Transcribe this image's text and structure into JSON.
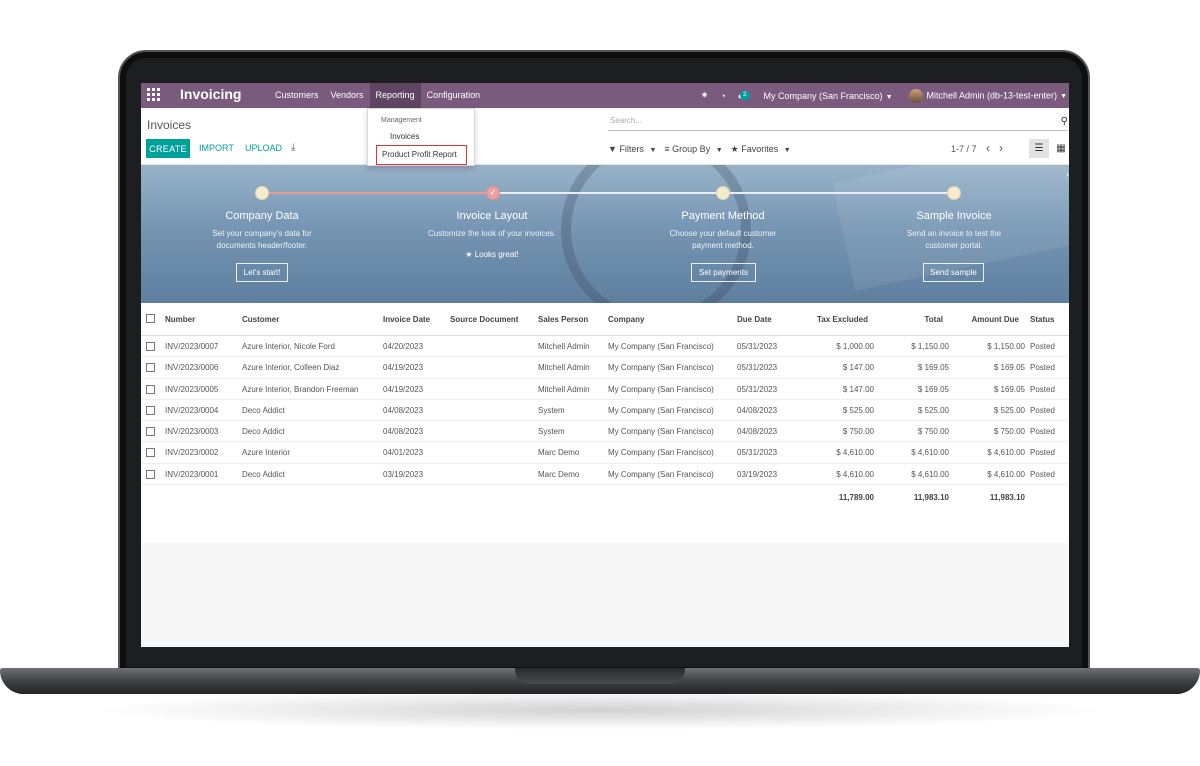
{
  "navbar": {
    "brand": "Invoicing",
    "menu": [
      "Customers",
      "Vendors",
      "Reporting",
      "Configuration"
    ],
    "chat_badge": "2",
    "company": "My Company (San Francisco)",
    "user": "Mitchell Admin (db-13-test-enter)"
  },
  "control_panel": {
    "title": "Invoices",
    "create_label": "CREATE",
    "import_label": "IMPORT",
    "upload_label": "UPLOAD",
    "search_placeholder": "Search...",
    "filters_label": "Filters",
    "group_by_label": "Group By",
    "favorites_label": "Favorites",
    "pager": "1-7 / 7"
  },
  "reporting_menu": {
    "header": "Management",
    "items": [
      "Invoices",
      "Product Profit Report"
    ]
  },
  "onboarding": {
    "steps": [
      {
        "title": "Company Data",
        "desc_line1": "Set your company's data for",
        "desc_line2": "documents header/footer.",
        "button": "Let's start!",
        "done": false
      },
      {
        "title": "Invoice Layout",
        "desc_line1": "Customize the look of your invoices.",
        "desc_line2": "",
        "button": "",
        "done": true,
        "done_label": "Looks great!"
      },
      {
        "title": "Payment Method",
        "desc_line1": "Choose your default customer",
        "desc_line2": "payment method.",
        "button": "Set payments",
        "done": false
      },
      {
        "title": "Sample Invoice",
        "desc_line1": "Send an invoice to test the",
        "desc_line2": "customer portal.",
        "button": "Send sample",
        "done": false
      }
    ]
  },
  "table": {
    "columns": [
      "Number",
      "Customer",
      "Invoice Date",
      "Source Document",
      "Sales Person",
      "Company",
      "Due Date",
      "Tax Excluded",
      "Total",
      "Amount Due",
      "Status"
    ],
    "rows": [
      {
        "number": "INV/2023/0007",
        "customer": "Azure Interior, Nicole Ford",
        "invoice_date": "04/20/2023",
        "source": "",
        "salesperson": "Mitchell Admin",
        "company": "My Company (San Francisco)",
        "due_date": "05/31/2023",
        "tax_excluded": "$ 1,000.00",
        "total": "$ 1,150.00",
        "amount_due": "$ 1,150.00",
        "status": "Posted"
      },
      {
        "number": "INV/2023/0006",
        "customer": "Azure Interior, Colleen Diaz",
        "invoice_date": "04/19/2023",
        "source": "",
        "salesperson": "Mitchell Admin",
        "company": "My Company (San Francisco)",
        "due_date": "05/31/2023",
        "tax_excluded": "$ 147.00",
        "total": "$ 169.05",
        "amount_due": "$ 169.05",
        "status": "Posted"
      },
      {
        "number": "INV/2023/0005",
        "customer": "Azure Interior, Brandon Freeman",
        "invoice_date": "04/19/2023",
        "source": "",
        "salesperson": "Mitchell Admin",
        "company": "My Company (San Francisco)",
        "due_date": "05/31/2023",
        "tax_excluded": "$ 147.00",
        "total": "$ 169.05",
        "amount_due": "$ 169.05",
        "status": "Posted"
      },
      {
        "number": "INV/2023/0004",
        "customer": "Deco Addict",
        "invoice_date": "04/08/2023",
        "source": "",
        "salesperson": "System",
        "company": "My Company (San Francisco)",
        "due_date": "04/08/2023",
        "tax_excluded": "$ 525.00",
        "total": "$ 525.00",
        "amount_due": "$ 525.00",
        "status": "Posted"
      },
      {
        "number": "INV/2023/0003",
        "customer": "Deco Addict",
        "invoice_date": "04/08/2023",
        "source": "",
        "salesperson": "System",
        "company": "My Company (San Francisco)",
        "due_date": "04/08/2023",
        "tax_excluded": "$ 750.00",
        "total": "$ 750.00",
        "amount_due": "$ 750.00",
        "status": "Posted"
      },
      {
        "number": "INV/2023/0002",
        "customer": "Azure Interior",
        "invoice_date": "04/01/2023",
        "source": "",
        "salesperson": "Marc Demo",
        "company": "My Company (San Francisco)",
        "due_date": "05/31/2023",
        "tax_excluded": "$ 4,610.00",
        "total": "$ 4,610.00",
        "amount_due": "$ 4,610.00",
        "status": "Posted"
      },
      {
        "number": "INV/2023/0001",
        "customer": "Deco Addict",
        "invoice_date": "03/19/2023",
        "source": "",
        "salesperson": "Marc Demo",
        "company": "My Company (San Francisco)",
        "due_date": "03/19/2023",
        "tax_excluded": "$ 4,610.00",
        "total": "$ 4,610.00",
        "amount_due": "$ 4,610.00",
        "status": "Posted"
      }
    ],
    "totals": {
      "tax_excluded": "11,789.00",
      "total": "11,983.10",
      "amount_due": "11,983.10"
    }
  },
  "colors": {
    "navbar": "#7a5a7d",
    "accent": "#00a09d",
    "highlight_border": "#d9343b"
  }
}
